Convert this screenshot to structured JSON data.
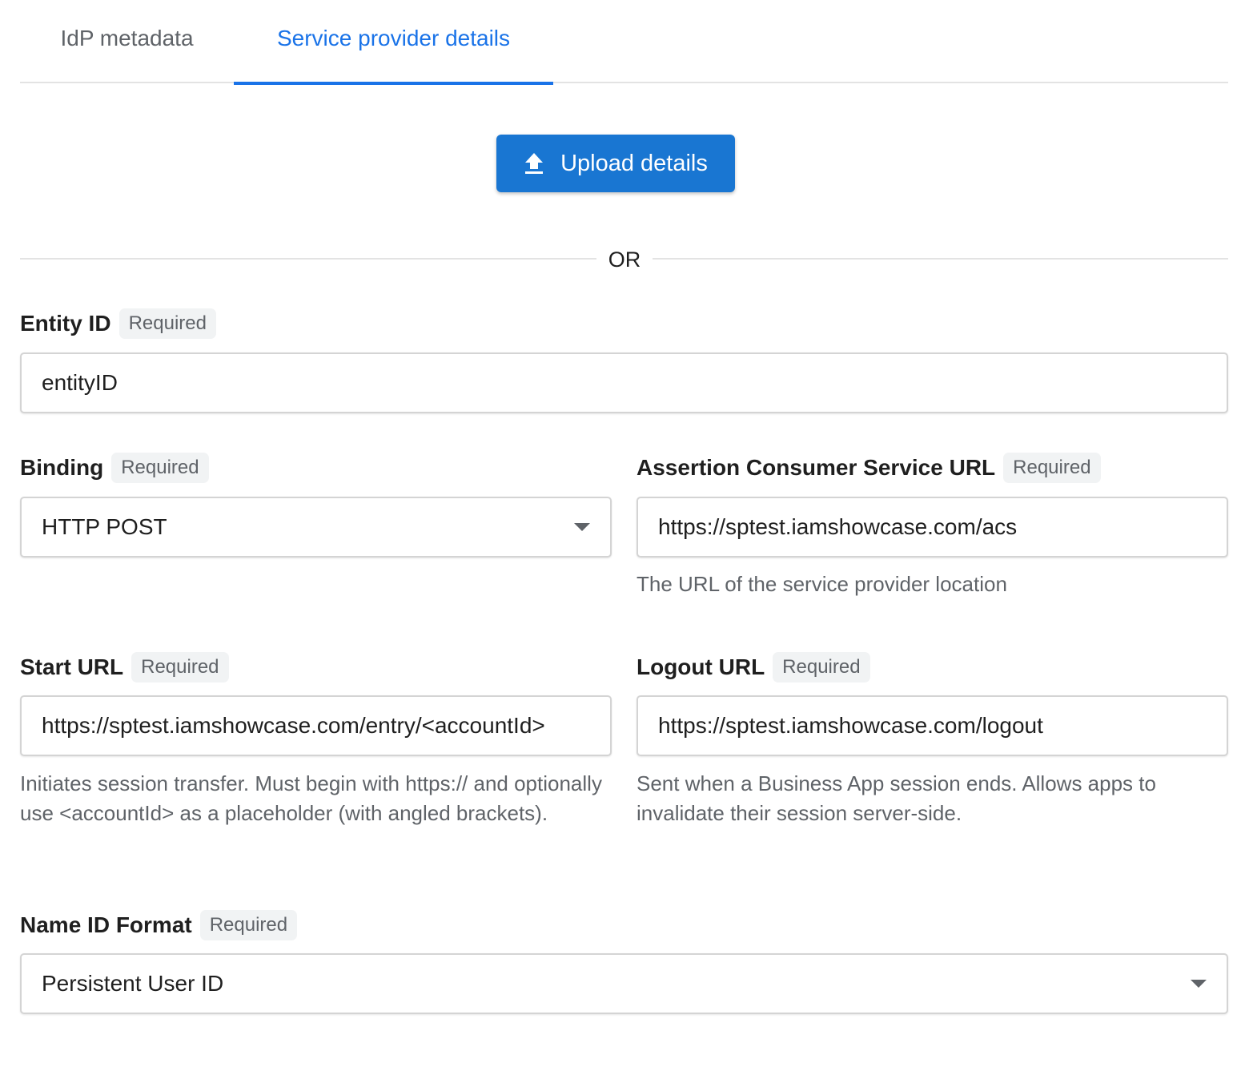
{
  "tabs": [
    {
      "label": "IdP metadata",
      "active": false
    },
    {
      "label": "Service provider details",
      "active": true
    }
  ],
  "upload": {
    "label": "Upload details",
    "icon": "upload-icon"
  },
  "divider": {
    "label": "OR"
  },
  "required_badge": "Required",
  "fields": {
    "entity_id": {
      "label": "Entity ID",
      "value": "entityID"
    },
    "binding": {
      "label": "Binding",
      "value": "HTTP POST"
    },
    "acs_url": {
      "label": "Assertion Consumer Service URL",
      "value": "https://sptest.iamshowcase.com/acs",
      "help": "The URL of the service provider location"
    },
    "start_url": {
      "label": "Start URL",
      "value": "https://sptest.iamshowcase.com/entry/<accountId>",
      "help": "Initiates session transfer. Must begin with https:// and optionally use <accountId> as a placeholder (with angled brackets)."
    },
    "logout_url": {
      "label": "Logout URL",
      "value": "https://sptest.iamshowcase.com/logout",
      "help": "Sent when a Business App session ends. Allows apps to invalidate their session server-side."
    },
    "name_id_format": {
      "label": "Name ID Format",
      "value": "Persistent User ID"
    }
  },
  "colors": {
    "accent": "#1a73e8",
    "button": "#1976d2",
    "muted": "#5f6368"
  }
}
